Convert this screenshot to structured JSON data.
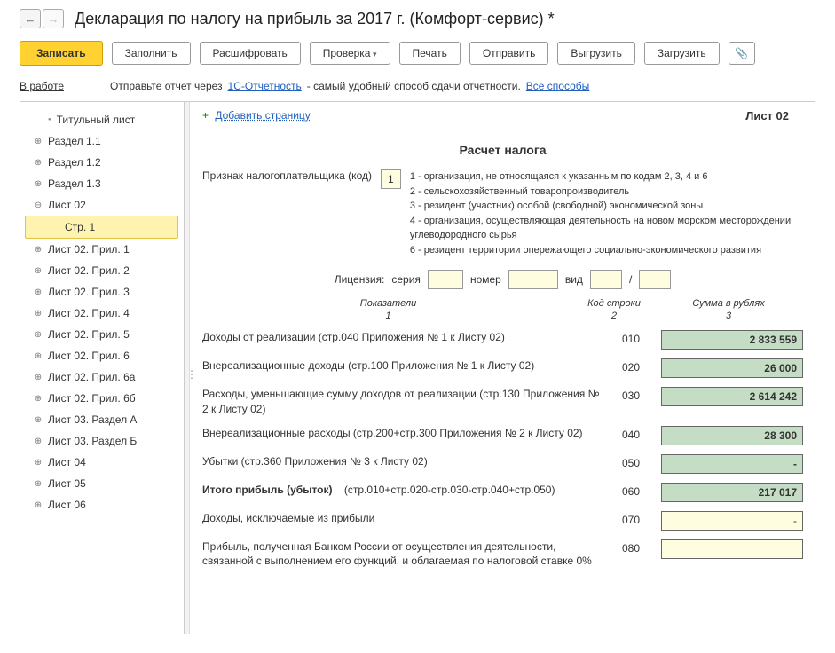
{
  "header": {
    "title": "Декларация по налогу на прибыль за 2017 г. (Комфорт-сервис) *"
  },
  "toolbar": {
    "write": "Записать",
    "fill": "Заполнить",
    "decode": "Расшифровать",
    "check": "Проверка",
    "print": "Печать",
    "send": "Отправить",
    "export": "Выгрузить",
    "import": "Загрузить"
  },
  "infoBar": {
    "status": "В работе",
    "text1": "Отправьте отчет через ",
    "link1": "1С-Отчетность",
    "text2": " - самый удобный способ сдачи отчетности. ",
    "link2": "Все способы"
  },
  "sidebar": {
    "items": [
      {
        "label": "Титульный лист",
        "type": "dot"
      },
      {
        "label": "Раздел 1.1",
        "type": "plus"
      },
      {
        "label": "Раздел 1.2",
        "type": "plus"
      },
      {
        "label": "Раздел 1.3",
        "type": "plus"
      },
      {
        "label": "Лист 02",
        "type": "minus"
      },
      {
        "label": "Стр. 1",
        "type": "active"
      },
      {
        "label": "Лист 02. Прил. 1",
        "type": "plus"
      },
      {
        "label": "Лист 02. Прил. 2",
        "type": "plus"
      },
      {
        "label": "Лист 02. Прил. 3",
        "type": "plus"
      },
      {
        "label": "Лист 02. Прил. 4",
        "type": "plus"
      },
      {
        "label": "Лист 02. Прил. 5",
        "type": "plus"
      },
      {
        "label": "Лист 02. Прил. 6",
        "type": "plus"
      },
      {
        "label": "Лист 02. Прил. 6а",
        "type": "plus"
      },
      {
        "label": "Лист 02. Прил. 6б",
        "type": "plus"
      },
      {
        "label": "Лист 03. Раздел А",
        "type": "plus"
      },
      {
        "label": "Лист 03. Раздел Б",
        "type": "plus"
      },
      {
        "label": "Лист 04",
        "type": "plus"
      },
      {
        "label": "Лист 05",
        "type": "plus"
      },
      {
        "label": "Лист 06",
        "type": "plus"
      }
    ]
  },
  "content": {
    "addPage": "Добавить страницу",
    "sheetLabel": "Лист 02",
    "calcTitle": "Расчет налога",
    "taxpayerLabel": "Признак налогоплательщика (код)",
    "taxpayerCode": "1",
    "codeDesc": "1 - организация, не относящаяся к указанным по кодам 2, 3, 4 и 6\n2 - сельскохозяйственный товаропроизводитель\n3 - резидент (участник) особой (свободной) экономической зоны\n4 - организация, осуществляющая деятельность на новом морском месторождении углеводородного сырья\n6 - резидент территории опережающего социально-экономического развития",
    "license": {
      "label": "Лицензия:",
      "series": "серия",
      "number": "номер",
      "type": "вид",
      "slash": "/"
    },
    "colHeaders": {
      "c1": "Показатели",
      "c2": "Код строки",
      "c3": "Сумма в рублях",
      "n1": "1",
      "n2": "2",
      "n3": "3"
    },
    "rows": [
      {
        "label": "Доходы от реализации (стр.040 Приложения № 1 к Листу 02)",
        "code": "010",
        "value": "2 833 559",
        "style": "green"
      },
      {
        "label": "Внереализационные доходы (стр.100 Приложения № 1 к Листу 02)",
        "code": "020",
        "value": "26 000",
        "style": "green"
      },
      {
        "label": "Расходы, уменьшающие сумму доходов от реализации (стр.130 Приложения № 2 к Листу 02)",
        "code": "030",
        "value": "2 614 242",
        "style": "green"
      },
      {
        "label": "Внереализационные расходы (стр.200+стр.300 Приложения № 2 к Листу 02)",
        "code": "040",
        "value": "28 300",
        "style": "green"
      },
      {
        "label": "Убытки (стр.360 Приложения № 3 к Листу 02)",
        "code": "050",
        "value": "-",
        "style": "green"
      },
      {
        "label": "Итого прибыль (убыток)      (стр.010+стр.020-стр.030-стр.040+стр.050)",
        "code": "060",
        "value": "217 017",
        "style": "green",
        "bold": true
      },
      {
        "label": "Доходы, исключаемые из прибыли",
        "code": "070",
        "value": "-",
        "style": "yellow"
      },
      {
        "label": "Прибыль, полученная Банком России от осуществления деятельности, связанной с выполнением его функций, и облагаемая по налоговой ставке 0%",
        "code": "080",
        "value": "",
        "style": "yellow"
      }
    ]
  }
}
